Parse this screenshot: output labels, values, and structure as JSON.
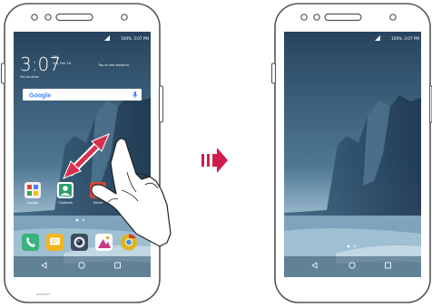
{
  "colors": {
    "arrow": "#cc1f4e",
    "swipe_arrow": "#d9304e",
    "sky_top": "#2c4f6b",
    "sea": "#8fb3c9"
  },
  "left_phone": {
    "status": {
      "battery": "100%",
      "time": "3:07 PM"
    },
    "clock": {
      "time": "3:07",
      "period": "PM",
      "date": "Sat, Feb 18"
    },
    "location": "Set location",
    "weather_hint": "Tap to see weather",
    "search": {
      "brand": "Google",
      "mic_icon": "mic-icon"
    },
    "apps": [
      {
        "label": "Google",
        "icon": "google-folder-icon"
      },
      {
        "label": "Contacts",
        "icon": "contacts-icon"
      },
      {
        "label": "Smart",
        "icon": "smart-icon"
      }
    ],
    "dock": [
      {
        "icon": "phone-icon"
      },
      {
        "icon": "messaging-icon"
      },
      {
        "icon": "camera-icon"
      },
      {
        "icon": "gallery-icon"
      },
      {
        "icon": "chrome-icon"
      }
    ],
    "nav": [
      "back-icon",
      "home-icon",
      "recents-icon"
    ]
  },
  "right_phone": {
    "status": {
      "battery": "100%",
      "time": "3:07 PM"
    },
    "nav": [
      "back-icon",
      "home-icon",
      "recents-icon"
    ]
  },
  "transition_arrow": {
    "icon": "triple-arrow-right-icon"
  }
}
